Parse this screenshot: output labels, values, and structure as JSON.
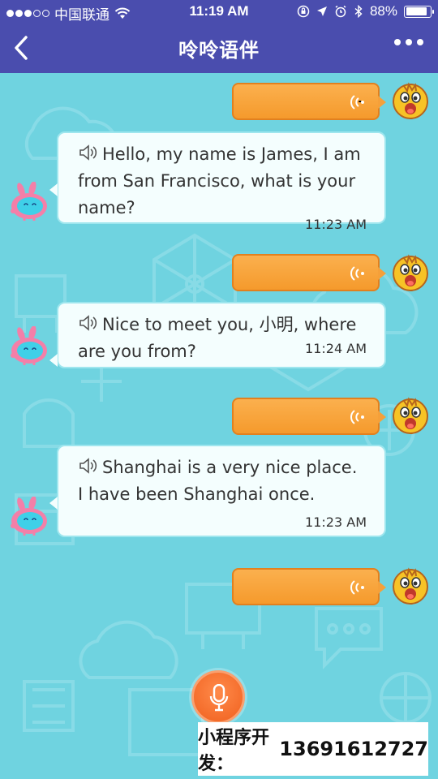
{
  "status_bar": {
    "carrier": "中国联通",
    "time": "11:19 AM",
    "battery": "88%",
    "battery_level": 0.88
  },
  "nav": {
    "title": "呤呤语伴",
    "back_icon": "chevron-left-icon",
    "more_icon": "more-dots-icon"
  },
  "messages": [
    {
      "type": "voice-out"
    },
    {
      "type": "text-in",
      "text": "Hello, my name is James, I am from San Francisco, what is your name?",
      "time": "11:23 AM"
    },
    {
      "type": "voice-out"
    },
    {
      "type": "text-in",
      "text": "Nice to meet you, 小明, where are you from?",
      "time": "11:24 AM"
    },
    {
      "type": "voice-out"
    },
    {
      "type": "text-in",
      "text": "Shanghai is a very nice place. I have been Shanghai once.",
      "time": "11:23 AM"
    },
    {
      "type": "voice-out"
    }
  ],
  "watermark": {
    "label": "小程序开发：",
    "phone": "13691612727"
  },
  "colors": {
    "header": "#4a4dae",
    "chat_bg": "#6fd3e0",
    "voice_bubble": "#f59a2c",
    "text_bubble": "#f4fefe",
    "mic_button": "#f0601e"
  }
}
